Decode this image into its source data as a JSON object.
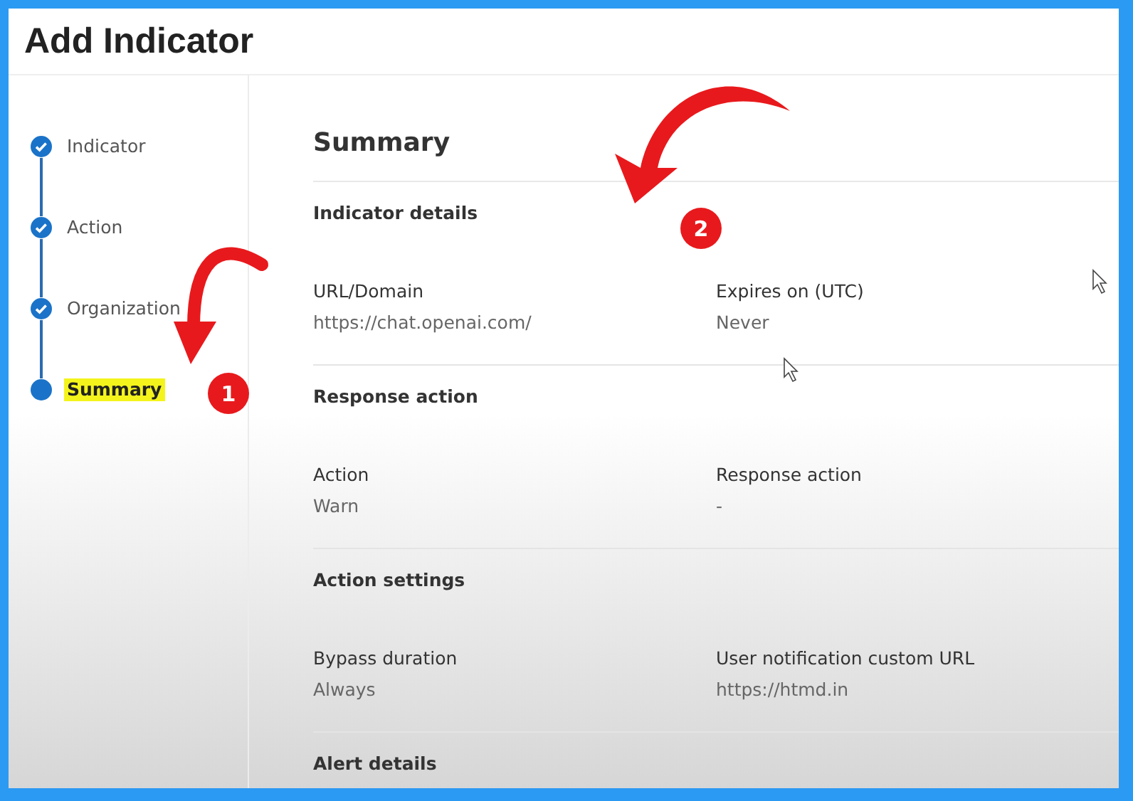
{
  "title": "Add Indicator",
  "steps": [
    {
      "label": "Indicator",
      "done": true,
      "selected": false,
      "highlighted": false
    },
    {
      "label": "Action",
      "done": true,
      "selected": false,
      "highlighted": false
    },
    {
      "label": "Organization",
      "done": true,
      "selected": false,
      "highlighted": false
    },
    {
      "label": "Summary",
      "done": false,
      "selected": true,
      "highlighted": true
    }
  ],
  "heading": "Summary",
  "sections": [
    {
      "title": "Indicator details",
      "fields": [
        {
          "label": "URL/Domain",
          "value": "https://chat.openai.com/"
        },
        {
          "label": "Expires on (UTC)",
          "value": "Never"
        }
      ]
    },
    {
      "title": "Response action",
      "fields": [
        {
          "label": "Action",
          "value": "Warn"
        },
        {
          "label": "Response action",
          "value": "-"
        }
      ]
    },
    {
      "title": "Action settings",
      "fields": [
        {
          "label": "Bypass duration",
          "value": "Always"
        },
        {
          "label": "User notification custom URL",
          "value": "https://htmd.in"
        }
      ]
    },
    {
      "title": "Alert details"
    }
  ],
  "annotations": [
    {
      "kind": "badge",
      "label": "1"
    },
    {
      "kind": "badge",
      "label": "2"
    }
  ]
}
